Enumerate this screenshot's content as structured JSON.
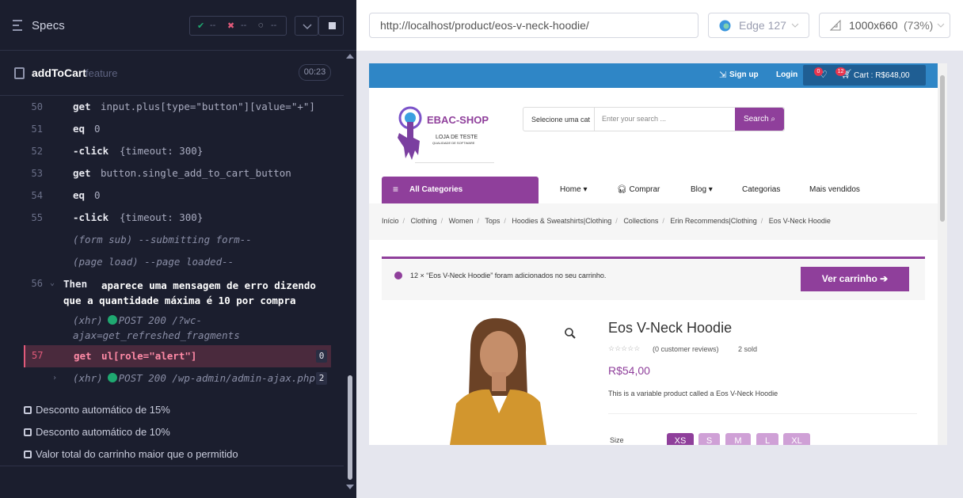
{
  "specs": {
    "title": "Specs",
    "pass": "--",
    "fail": "--",
    "pending": "--"
  },
  "feature": {
    "name": "addToCart",
    "tag": "feature",
    "timer": "00:23"
  },
  "commands": [
    {
      "line": "50",
      "cmd": "get",
      "arg": "input.plus[type=\"button\"][value=\"+\"]"
    },
    {
      "line": "51",
      "cmd": "eq",
      "arg": "0"
    },
    {
      "line": "52",
      "cmd": "-click",
      "arg": "{timeout: 300}"
    },
    {
      "line": "53",
      "cmd": "get",
      "arg": "button.single_add_to_cart_button"
    },
    {
      "line": "54",
      "cmd": "eq",
      "arg": "0"
    },
    {
      "line": "55",
      "cmd": "-click",
      "arg": "{timeout: 300}"
    }
  ],
  "events": {
    "form": "(form sub)  --submitting form--",
    "page": "(page load)  --page loaded--"
  },
  "then": {
    "line": "56",
    "keyword": "Then",
    "text": "aparece uma mensagem de erro dizendo que a quantidade máxima é 10 por compra"
  },
  "xhr1": {
    "prefix": "(xhr)",
    "text": "POST 200 /?wc-ajax=get_refreshed_fragments"
  },
  "active": {
    "line": "57",
    "cmd": "get",
    "arg": "ul[role=\"alert\"]",
    "count": "0"
  },
  "xhr2": {
    "prefix": "(xhr)",
    "text": "POST 200 /wp-admin/admin-ajax.php",
    "count": "2"
  },
  "tests": [
    "Desconto automático de 15%",
    "Desconto automático de 10%",
    "Valor total do carrinho maior que o permitido"
  ],
  "browserbar": {
    "url": "http://localhost/product/eos-v-neck-hoodie/",
    "browser": "Edge 127",
    "viewport": "1000x660",
    "scale": "(73%)"
  },
  "site": {
    "signup": "Sign up",
    "login": "Login",
    "wish_count": "0",
    "cart_count": "12",
    "cart": "Cart : R$648,00",
    "logo": "EBAC-SHOP",
    "logo_sub": "LOJA DE TESTE",
    "logo_sub2": "QUALIDADE DE SOFTWARE",
    "search_cat": "Selecione uma cat",
    "search_placeholder": "Enter your search ...",
    "search_btn": "Search",
    "all_categories": "All Categories",
    "nav": [
      "Home",
      "Comprar",
      "Blog",
      "Categorias",
      "Mais vendidos"
    ],
    "breadcrumb": [
      "Início",
      "Clothing",
      "Women",
      "Tops",
      "Hoodies & Sweatshirts|Clothing",
      "Collections",
      "Erin Recommends|Clothing",
      "Eos V-Neck Hoodie"
    ],
    "notice": "12 × “Eos V-Neck Hoodie” foram adicionados no seu carrinho.",
    "notice_btn": "Ver carrinho",
    "product_title": "Eos V-Neck Hoodie",
    "stars": "☆☆☆☆☆",
    "reviews": "(0 customer reviews)",
    "sold": "2 sold",
    "price": "R$54,00",
    "desc": "This is a variable product called a Eos V-Neck Hoodie",
    "size_label": "Size",
    "sizes": [
      "XS",
      "S",
      "M",
      "L",
      "XL"
    ]
  },
  "colors": {
    "accent": "#8f3f9b",
    "topbar": "#2f86c6",
    "pass": "#1fa971",
    "fail": "#e25a7a"
  }
}
